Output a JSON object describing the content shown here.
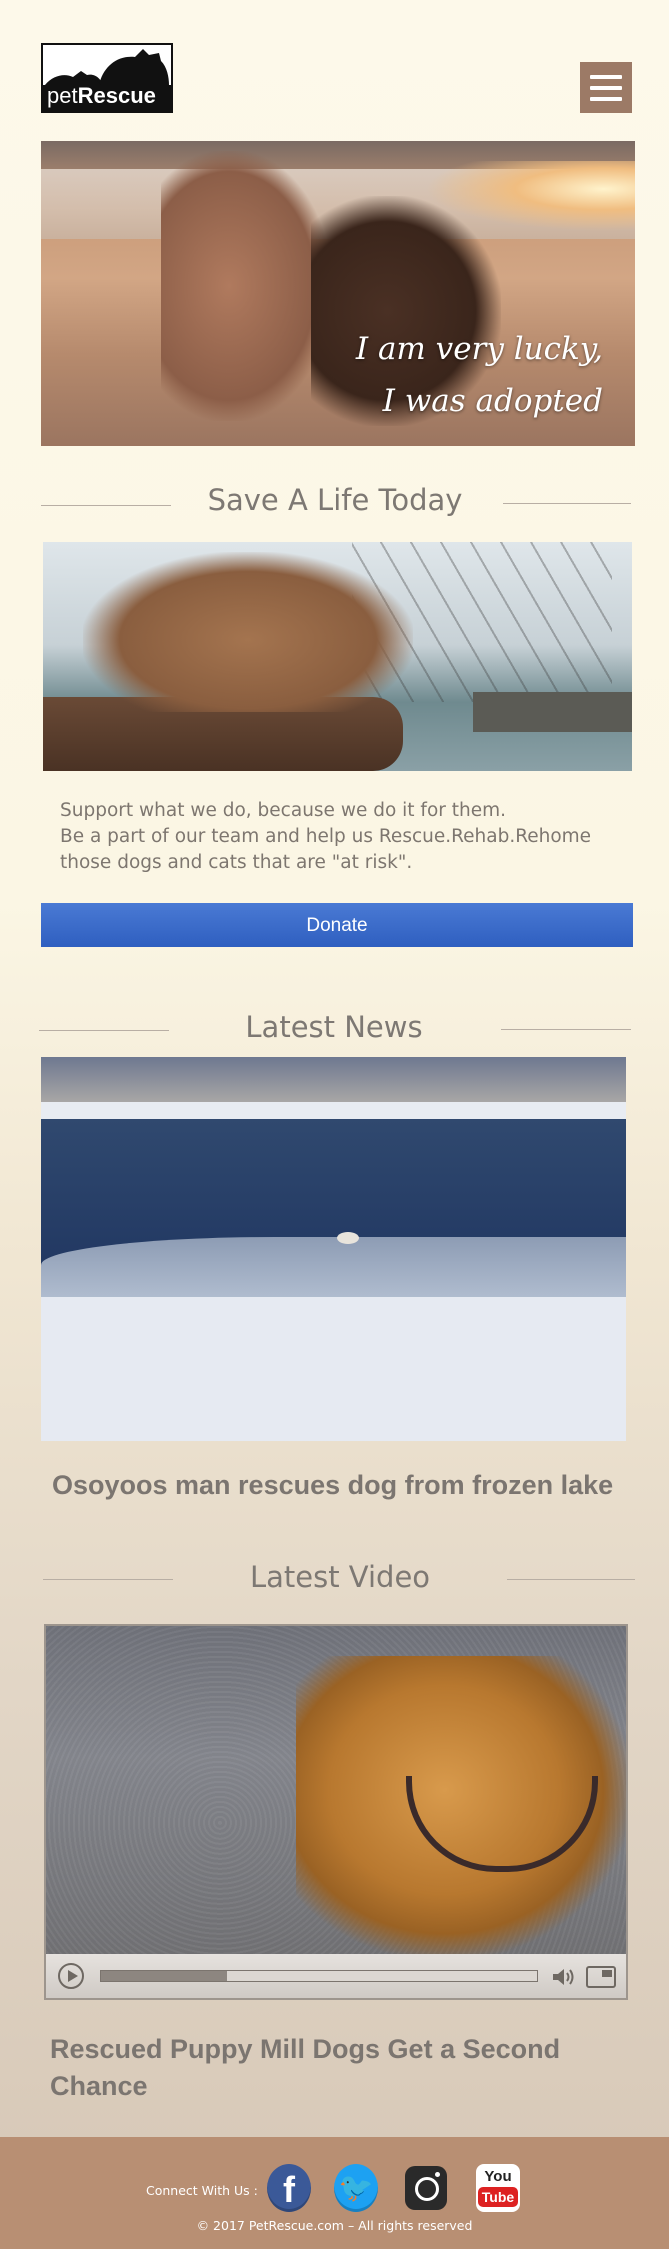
{
  "header": {
    "logo_text_pet": "pet",
    "logo_text_rescue": "Rescue",
    "menu_icon": "hamburger-icon"
  },
  "hero": {
    "caption_line1": "I am very lucky,",
    "caption_line2": "I was adopted"
  },
  "save_section": {
    "title": "Save A Life Today",
    "body_line1": "Support what we do, because we do it for them.",
    "body_line2": "Be a part of our team and help us Rescue.Rehab.Rehome",
    "body_line3": "those dogs and cats that are \"at risk\".",
    "donate_label": "Donate"
  },
  "news_section": {
    "title": "Latest News",
    "headline": "Osoyoos man rescues dog from frozen lake"
  },
  "video_section": {
    "title": "Latest Video",
    "headline_line1": "Rescued Puppy Mill Dogs Get a Second",
    "headline_line2": "Chance",
    "progress": 0.29,
    "icons": [
      "play-icon",
      "volume-icon",
      "fullscreen-icon"
    ]
  },
  "footer": {
    "connect_label": "Connect With Us :",
    "social": {
      "facebook_glyph": "f",
      "twitter_glyph": "🐦",
      "youtube_you": "You",
      "youtube_tube": "Tube"
    },
    "copyright": "© 2017 PetRescue.com – All rights reserved"
  },
  "colors": {
    "accent_brown": "#b88f73",
    "donate_blue": "#3a6bcb",
    "heading_gray": "#7d7873"
  }
}
